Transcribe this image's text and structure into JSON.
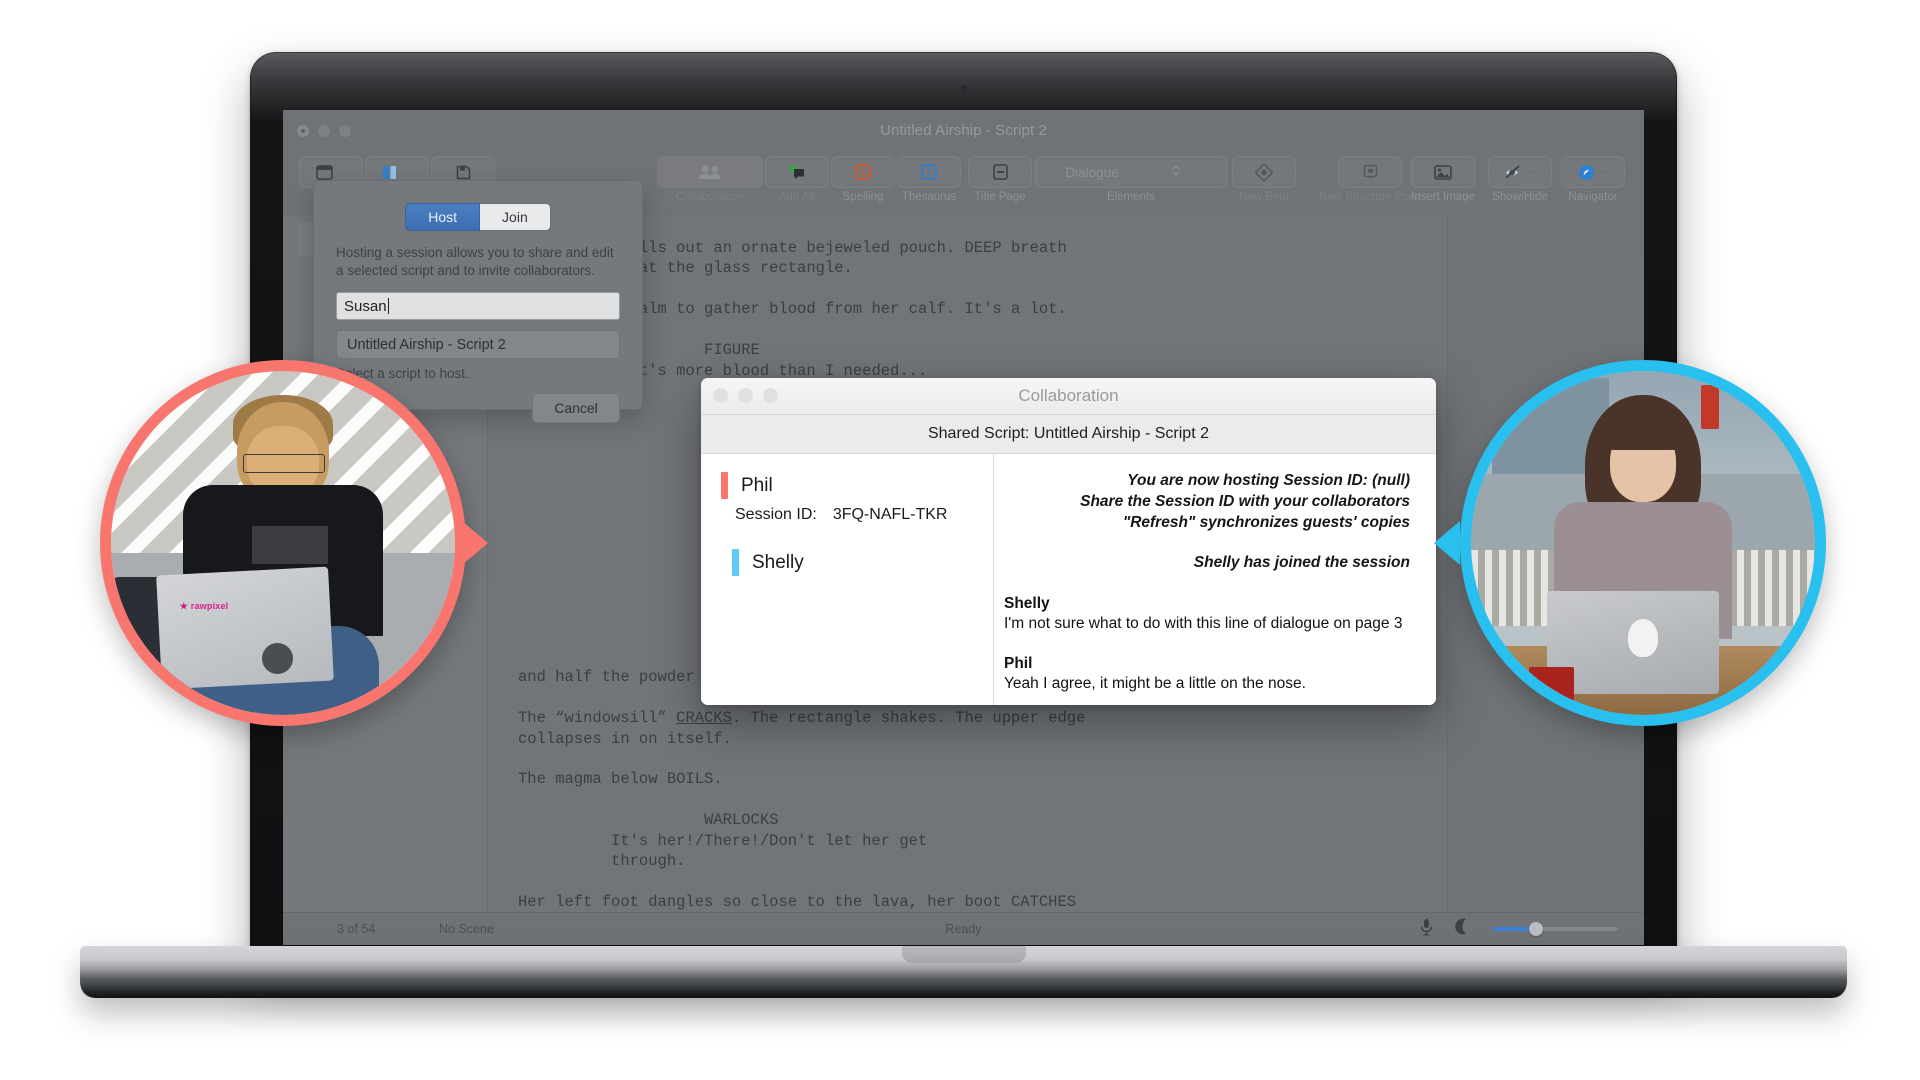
{
  "app": {
    "title": "Untitled Airship - Script 2",
    "toolbar": {
      "left": [
        {
          "label": "Views",
          "icon": "views-icon",
          "chevron": true
        },
        {
          "label": "Split",
          "icon": "split-icon",
          "chevron": true
        },
        {
          "label": "Save",
          "icon": "save-icon",
          "chevron": false
        }
      ],
      "middle": [
        {
          "label": "Collaboration",
          "icon": "collaboration-icon",
          "dim": true
        },
        {
          "label": "Add Alt",
          "icon": "add-alt-icon",
          "dim": true
        },
        {
          "label": "Spelling",
          "icon": "spelling-icon",
          "dim": false
        },
        {
          "label": "Thesaurus",
          "icon": "thesaurus-icon",
          "dim": false
        }
      ],
      "center": [
        {
          "label": "Title Page",
          "icon": "title-page-icon"
        }
      ],
      "elements": {
        "label": "Elements",
        "value": "Dialogue"
      },
      "structure": [
        {
          "label": "New Beat",
          "icon": "new-beat-icon",
          "dim": true
        },
        {
          "label": "New Structure Point",
          "icon": "new-structure-point-icon",
          "dim": true
        }
      ],
      "right": [
        {
          "label": "Insert Image",
          "icon": "insert-image-icon",
          "chevron": false
        },
        {
          "label": "Show/Hide",
          "icon": "show-hide-icon",
          "chevron": true
        },
        {
          "label": "Navigator",
          "icon": "navigator-icon",
          "chevron": true
        }
      ]
    },
    "document_top": "The Figure pulls out an ornate bejeweled pouch. DEEP breath\nas she looks at the glass rectangle.\n\nShe wipes a palm to gather blood from her calf. It's a lot.\n\n                    FIGURE\n          That's more blood than I needed...",
    "document_bottom_1": "and half the powder comes billowing out of her mouth.\n\nThe “windowsill” ",
    "document_bottom_cracks": "CRACKS",
    "document_bottom_2": ". The rectangle shakes. The upper edge\ncollapses in on itself.\n\nThe magma below BOILS.\n\n                    WARLOCKS\n          It's her!/There!/Don't let her get\n          through.\n\nHer left foot dangles so close to the lava, her boot CATCHES",
    "statusbar": {
      "page": "3 of 54",
      "scene": "No Scene",
      "status": "Ready",
      "mic_icon": "microphone-icon",
      "moon_icon": "moon-icon",
      "zoom_slider": "zoom-slider"
    }
  },
  "host_sheet": {
    "tab_host": "Host",
    "tab_join": "Join",
    "description": "Hosting a session allows you to share and edit a selected script and to invite collaborators.",
    "name_value": "Susan",
    "script_value": "Untitled Airship - Script 2",
    "hint": "Select a script to host.",
    "cancel_label": "Cancel"
  },
  "collaboration": {
    "window_title": "Collaboration",
    "subtitle": "Shared Script: Untitled Airship - Script 2",
    "participants": [
      {
        "name": "Phil",
        "color": "#f9766f"
      },
      {
        "name": "Shelly",
        "color": "#5ecbf5"
      }
    ],
    "session_label": "Session ID:",
    "session_id": "3FQ-NAFL-TKR",
    "system_messages": [
      "You are now hosting Session ID: (null)",
      "Share the Session ID with your collaborators",
      "\"Refresh\" synchronizes guests' copies",
      "Shelly has joined the session"
    ],
    "messages": [
      {
        "author": "Shelly",
        "text": "I'm not sure what to do with this line of dialogue on page 3"
      },
      {
        "author": "Phil",
        "text": "Yeah I agree, it might be a little on the nose."
      }
    ]
  },
  "avatars": [
    {
      "name": "left-participant-avatar",
      "ring_color": "#f9766f",
      "side": "left"
    },
    {
      "name": "right-participant-avatar",
      "ring_color": "#29c0ef",
      "side": "right"
    }
  ],
  "colors": {
    "accent_coral": "#f9766f",
    "accent_blue": "#29c0ef",
    "host_tab_blue": "#3c6fb2"
  }
}
